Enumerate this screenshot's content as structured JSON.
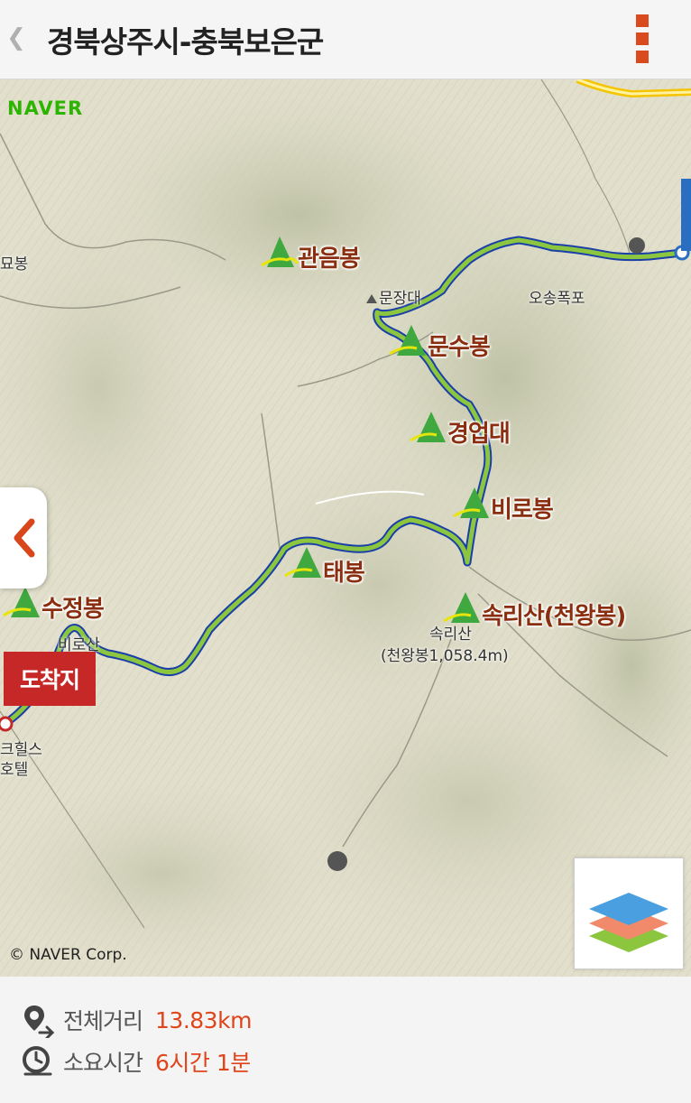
{
  "header": {
    "back_icon": "chevron-left-icon",
    "title": "경북상주시-충북보은군",
    "menu_icon": "kebab-menu-icon"
  },
  "map": {
    "provider_logo": "NAVER",
    "copyright": "© NAVER Corp.",
    "peaks": [
      {
        "name": "관음봉"
      },
      {
        "name": "문수봉"
      },
      {
        "name": "경업대"
      },
      {
        "name": "비로봉"
      },
      {
        "name": "태봉"
      },
      {
        "name": "속리산(천왕봉)"
      },
      {
        "name": "수정봉"
      }
    ],
    "places": [
      {
        "name": "오송폭포"
      },
      {
        "name": "속리산"
      },
      {
        "name": "(천왕봉1,058.4m)"
      },
      {
        "name": "묘봉"
      },
      {
        "name": "문장대"
      },
      {
        "name": "크힐스"
      },
      {
        "name": "호텔"
      },
      {
        "name": "비로산"
      }
    ],
    "arrival_label": "도착지",
    "side_toggle_icon": "chevron-left-icon",
    "layers_icon": "layers-icon",
    "route_colors": {
      "fill": "#8cc63f",
      "outline": "#1a3fa8"
    }
  },
  "summary": {
    "distance_label": "전체거리",
    "distance_value": "13.83km",
    "time_label": "소요시간",
    "time_value": "6시간 1분"
  }
}
